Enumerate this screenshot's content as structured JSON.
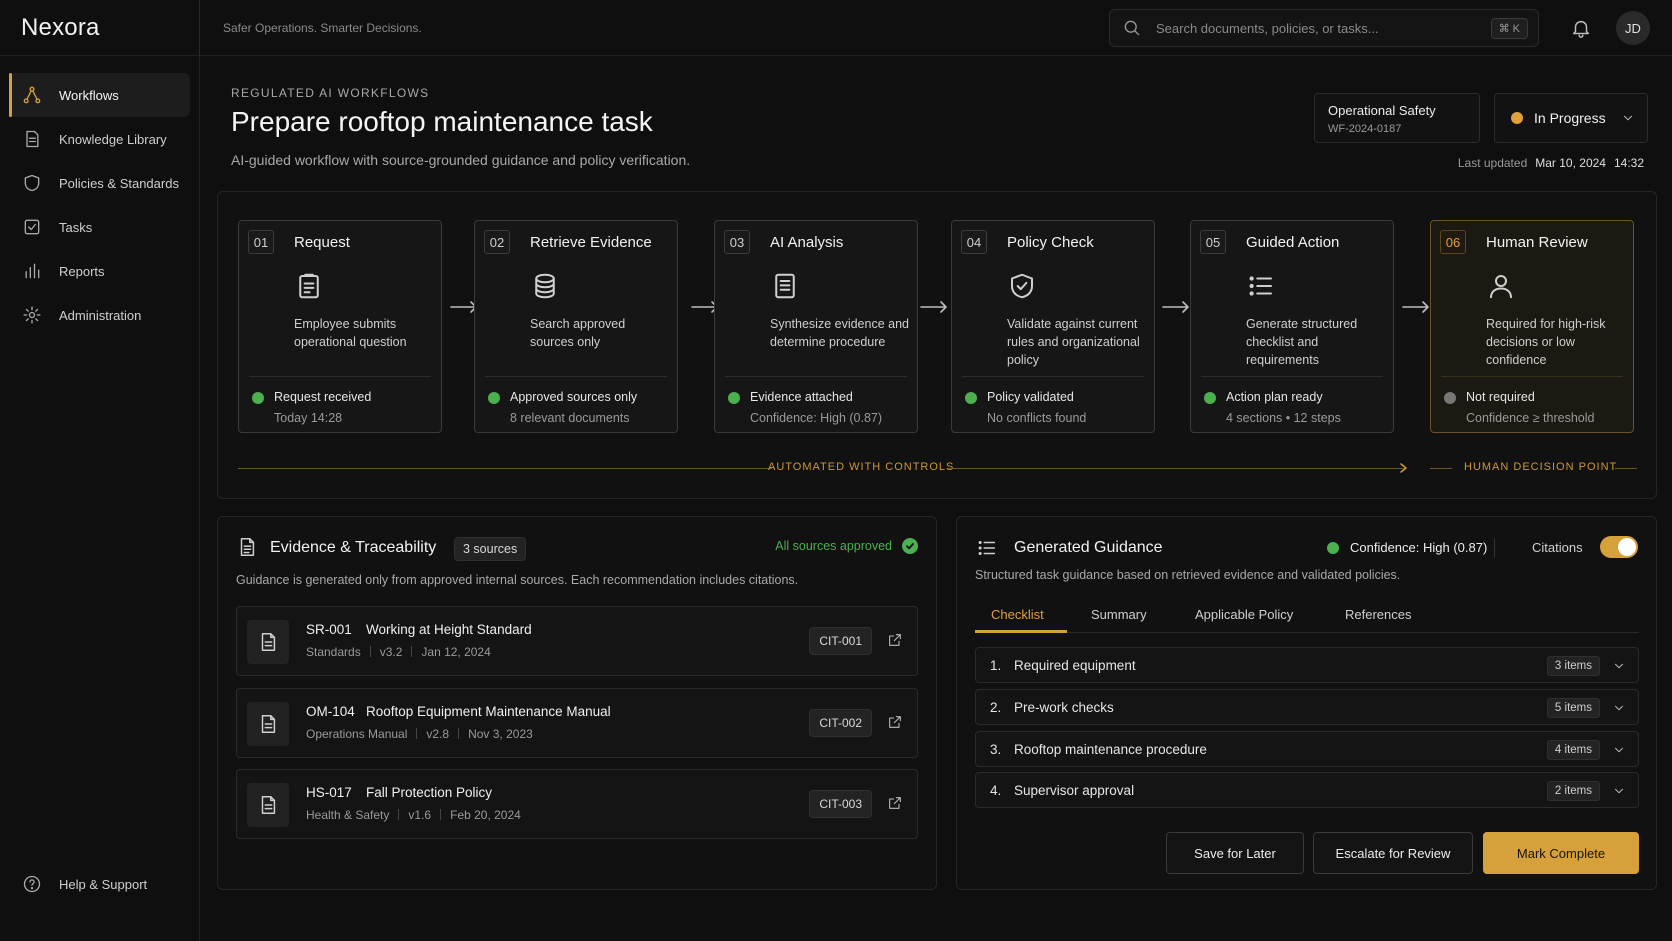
{
  "app": {
    "brand": "Nexora",
    "tagline": "Safer Operations. Smarter Decisions."
  },
  "search": {
    "placeholder": "Search documents, policies, or tasks...",
    "shortcut": "⌘ K"
  },
  "user": {
    "initials": "JD"
  },
  "sidebar": {
    "items": [
      {
        "label": "Workflows",
        "icon": "workflow-icon",
        "active": true
      },
      {
        "label": "Knowledge Library",
        "icon": "document-icon"
      },
      {
        "label": "Policies & Standards",
        "icon": "shield-icon"
      },
      {
        "label": "Tasks",
        "icon": "checkbox-icon"
      },
      {
        "label": "Reports",
        "icon": "bar-chart-icon"
      },
      {
        "label": "Administration",
        "icon": "gear-icon"
      }
    ],
    "help": "Help & Support"
  },
  "header": {
    "eyebrow": "REGULATED AI WORKFLOWS",
    "title": "Prepare rooftop maintenance task",
    "subtitle": "AI-guided workflow with source-grounded guidance and policy verification.",
    "category": "Operational Safety",
    "workflow_id": "WF-2024-0187",
    "status": "In Progress",
    "status_color": "#e0a03a",
    "updated_label": "Last updated",
    "updated_date": "Mar 10, 2024",
    "updated_time": "14:32"
  },
  "pipeline": {
    "steps": [
      {
        "num": "01",
        "title": "Request",
        "icon": "clipboard-icon",
        "desc": "Employee submits operational question",
        "status": "Request received",
        "detail": "Today 14:28",
        "state": "done"
      },
      {
        "num": "02",
        "title": "Retrieve Evidence",
        "icon": "database-icon",
        "desc": "Search approved sources only",
        "status": "Approved sources only",
        "detail": "8 relevant documents",
        "state": "done"
      },
      {
        "num": "03",
        "title": "AI Analysis",
        "icon": "document-icon",
        "desc": "Synthesize evidence and determine procedure",
        "status": "Evidence attached",
        "detail": "Confidence: High (0.87)",
        "state": "done"
      },
      {
        "num": "04",
        "title": "Policy Check",
        "icon": "shield-check-icon",
        "desc": "Validate against current rules and organizational policy",
        "status": "Policy validated",
        "detail": "No conflicts found",
        "state": "done"
      },
      {
        "num": "05",
        "title": "Guided Action",
        "icon": "list-icon",
        "desc": "Generate structured checklist and requirements",
        "status": "Action plan ready",
        "detail": "4 sections • 12 steps",
        "state": "done"
      },
      {
        "num": "06",
        "title": "Human Review",
        "icon": "user-icon",
        "desc": "Required for high-risk decisions or low confidence",
        "status": "Not required",
        "detail": "Confidence ≥ threshold",
        "state": "skipped"
      }
    ],
    "automated_label": "AUTOMATED WITH CONTROLS",
    "human_label": "HUMAN DECISION POINT"
  },
  "evidence": {
    "title": "Evidence & Traceability",
    "badge": "3 sources",
    "approved_label": "All sources approved",
    "subtitle": "Guidance is generated only from approved internal sources. Each recommendation includes citations.",
    "sources": [
      {
        "id": "SR-001",
        "name": "Working at Height Standard",
        "category": "Standards",
        "version": "v3.2",
        "date": "Jan 12, 2024",
        "citation": "CIT-001"
      },
      {
        "id": "OM-104",
        "name": "Rooftop Equipment Maintenance Manual",
        "category": "Operations Manual",
        "version": "v2.8",
        "date": "Nov 3, 2023",
        "citation": "CIT-002"
      },
      {
        "id": "HS-017",
        "name": "Fall Protection Policy",
        "category": "Health & Safety",
        "version": "v1.6",
        "date": "Feb 20, 2024",
        "citation": "CIT-003"
      }
    ]
  },
  "guidance": {
    "title": "Generated Guidance",
    "confidence": "Confidence: High (0.87)",
    "citations_label": "Citations",
    "citations_on": true,
    "subtitle": "Structured task guidance based on retrieved evidence and validated policies.",
    "tabs": [
      "Checklist",
      "Summary",
      "Applicable Policy",
      "References"
    ],
    "active_tab": "Checklist",
    "sections": [
      {
        "num": "1.",
        "title": "Required equipment",
        "count": "3 items"
      },
      {
        "num": "2.",
        "title": "Pre-work checks",
        "count": "5 items"
      },
      {
        "num": "3.",
        "title": "Rooftop maintenance procedure",
        "count": "4 items"
      },
      {
        "num": "4.",
        "title": "Supervisor approval",
        "count": "2 items"
      }
    ],
    "actions": {
      "save": "Save for Later",
      "escalate": "Escalate for Review",
      "complete": "Mark Complete"
    }
  },
  "colors": {
    "accent": "#d6a03a",
    "success": "#4caf50",
    "neutral": "#777777"
  }
}
